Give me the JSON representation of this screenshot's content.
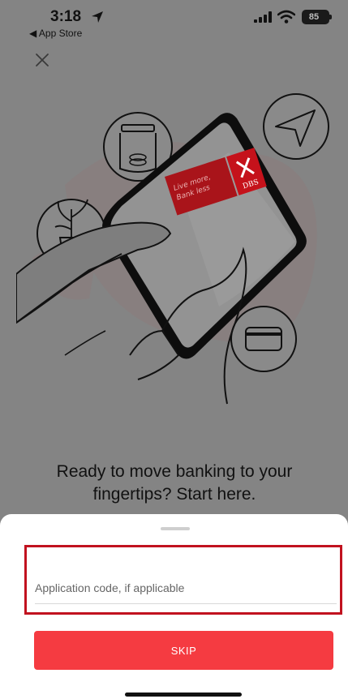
{
  "status_bar": {
    "time": "3:18",
    "back_app": "◀ App Store",
    "battery": "85",
    "icons": [
      "location-arrow-icon",
      "signal-icon",
      "wifi-icon",
      "battery-icon"
    ]
  },
  "header": {
    "close_icon": "close-icon"
  },
  "illustration": {
    "card_text": "Live more, Bank less",
    "brand": "DBS",
    "icons": [
      "coin-jar-icon",
      "plant-pot-icon",
      "send-paper-plane-icon",
      "credit-card-icon"
    ]
  },
  "main": {
    "headline": "Ready to move banking to your fingertips? Start here."
  },
  "sheet": {
    "code_input_placeholder": "Application code, if applicable",
    "code_input_value": "",
    "skip_label": "SKIP"
  },
  "colors": {
    "accent": "#f53b41",
    "highlight_border": "#c1121f",
    "overlay": "#848484"
  }
}
